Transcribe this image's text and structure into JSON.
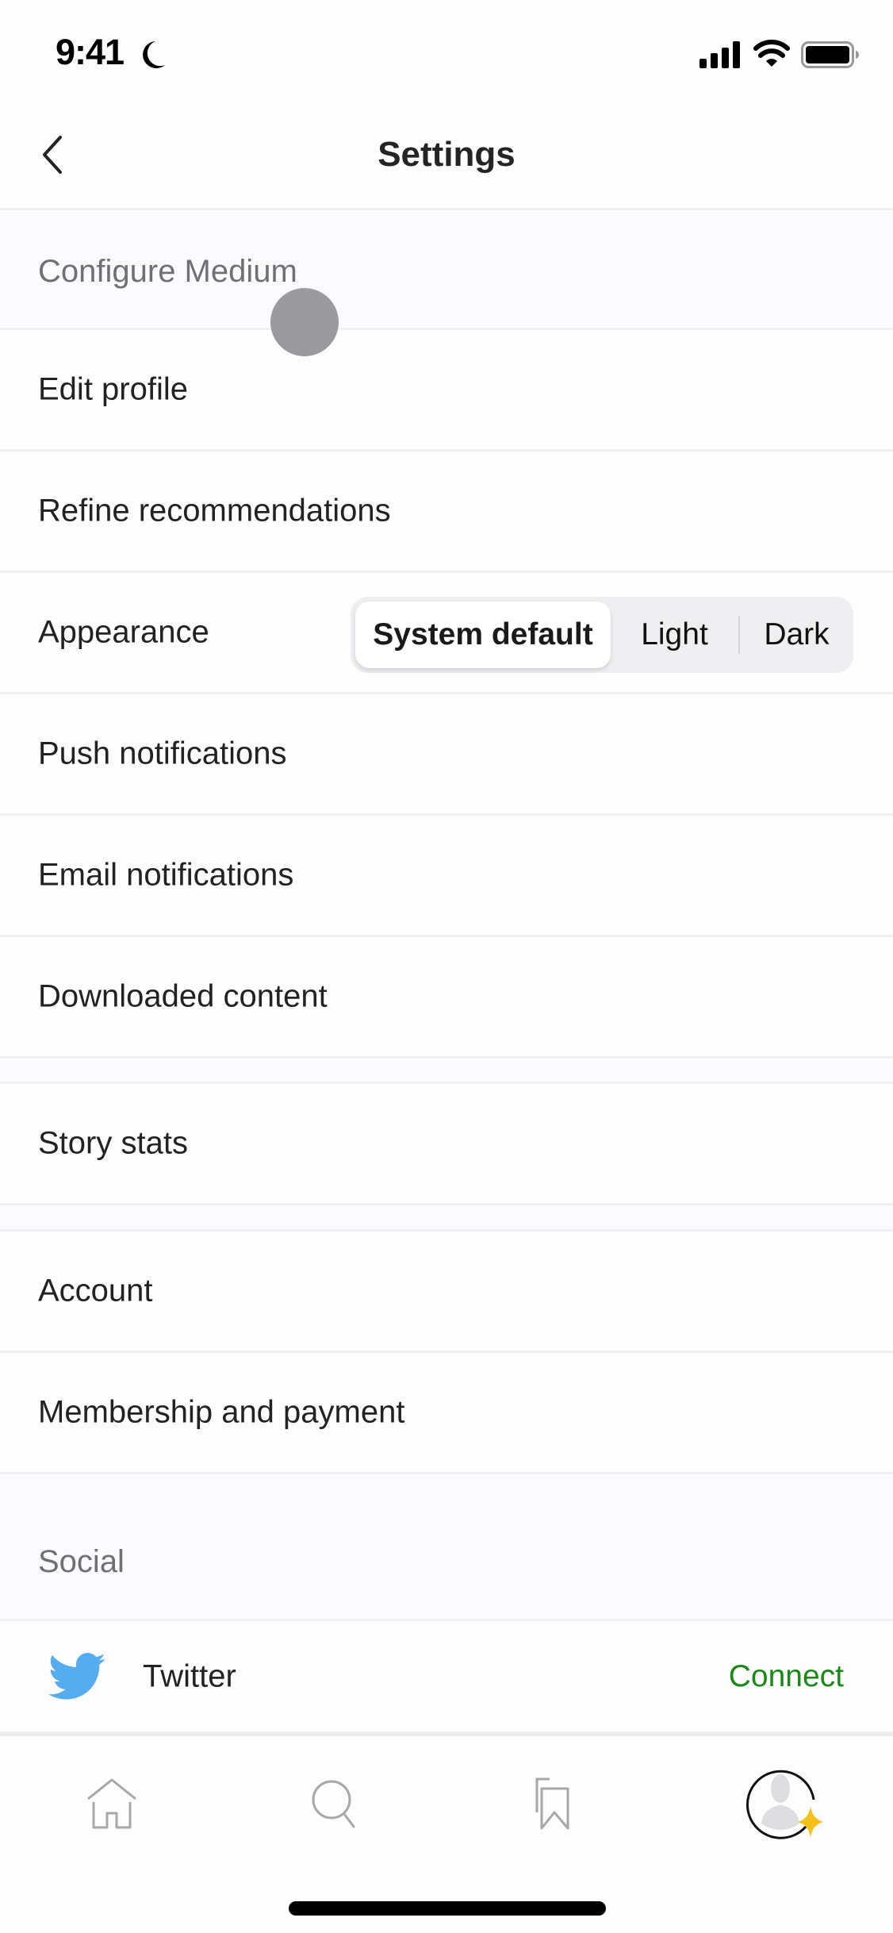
{
  "status_bar": {
    "time": "9:41",
    "icons": [
      "moon-icon",
      "cellular-signal-icon",
      "wifi-icon",
      "battery-icon"
    ]
  },
  "nav": {
    "title": "Settings",
    "back_icon": "chevron-left-icon"
  },
  "sections": {
    "configure": {
      "header": "Configure Medium",
      "items": [
        {
          "label": "Edit profile"
        },
        {
          "label": "Refine recommendations"
        },
        {
          "label": "Appearance"
        },
        {
          "label": "Push notifications"
        },
        {
          "label": "Email notifications"
        },
        {
          "label": "Downloaded content"
        }
      ]
    },
    "stats": {
      "items": [
        {
          "label": "Story stats"
        }
      ]
    },
    "account": {
      "items": [
        {
          "label": "Account"
        },
        {
          "label": "Membership and payment"
        }
      ]
    },
    "social": {
      "header": "Social",
      "items": [
        {
          "label": "Twitter",
          "icon": "twitter-bird-icon",
          "action": "Connect"
        }
      ]
    }
  },
  "appearance": {
    "options": [
      "System default",
      "Light",
      "Dark"
    ],
    "selected": "System default"
  },
  "tab_bar": {
    "tabs": [
      {
        "name": "home",
        "icon": "home-icon"
      },
      {
        "name": "search",
        "icon": "search-icon"
      },
      {
        "name": "library",
        "icon": "bookmarks-icon"
      },
      {
        "name": "profile",
        "icon": "avatar-icon",
        "badge": "member-star-icon"
      }
    ]
  },
  "colors": {
    "accent_green": "#1a8917",
    "twitter_blue": "#55acee",
    "member_star": "#f5c01a",
    "section_bg": "#fbfafc"
  }
}
